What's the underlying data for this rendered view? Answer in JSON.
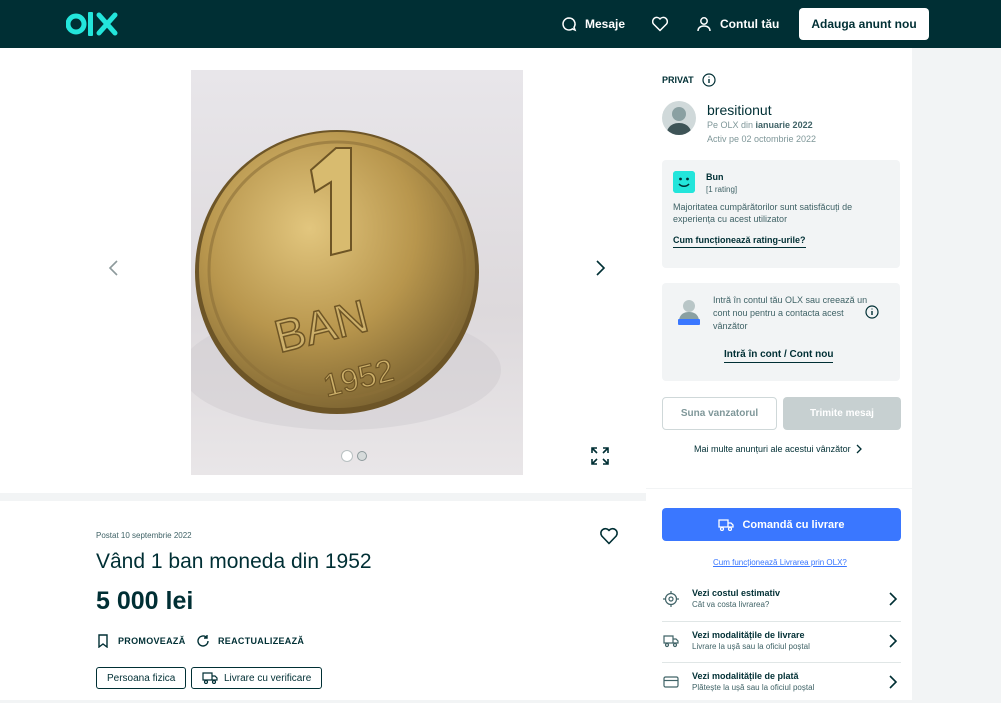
{
  "header": {
    "messages_label": "Mesaje",
    "account_label": "Contul tău",
    "post_ad_label": "Adauga anunt nou",
    "colors": {
      "background": "#002f34",
      "logo": "#23e5db"
    }
  },
  "gallery": {
    "image_count": 2,
    "active_index": 0,
    "image_subject": "1 ban coin 1952"
  },
  "listing": {
    "posted": "Postat 10 septembrie 2022",
    "title": "Vând 1 ban moneda din 1952",
    "price": "5 000 lei",
    "promote_label": "PROMOVEAZĂ",
    "refresh_label": "REACTUALIZEAZĂ",
    "tags": [
      "Persoana fizica",
      "Livrare cu verificare"
    ]
  },
  "seller": {
    "type_label": "PRIVAT",
    "name": "bresitionut",
    "since_prefix": "Pe OLX din",
    "since_date": "ianuarie 2022",
    "active": "Activ pe 02 octombrie 2022",
    "rating": {
      "label": "Bun",
      "count": "[1 rating]",
      "description": "Majoritatea cumpărătorilor sunt satisfăcuți de experiența cu acest utilizator",
      "link": "Cum funcționează rating-urile?"
    },
    "login": {
      "text": "Intră în contul tău OLX sau creează un cont nou pentru a contacta acest vânzător",
      "link": "Intră în cont / Cont nou"
    },
    "call_button": "Suna vanzatorul",
    "message_button": "Trimite mesaj",
    "more_ads": "Mai multe anunțuri ale acestui vânzător"
  },
  "delivery": {
    "order_button": "Comandă cu livrare",
    "how_link": "Cum funcționează Livrarea prin OLX?",
    "rows": [
      {
        "title": "Vezi costul estimativ",
        "subtitle": "Cât va costa livrarea?"
      },
      {
        "title": "Vezi modalitățile de livrare",
        "subtitle": "Livrare la ușă sau la oficiul poștal"
      },
      {
        "title": "Vezi modalitățile de plată",
        "subtitle": "Plătește la ușă sau la oficiul poștal"
      }
    ],
    "accent_color": "#3a77ff"
  }
}
